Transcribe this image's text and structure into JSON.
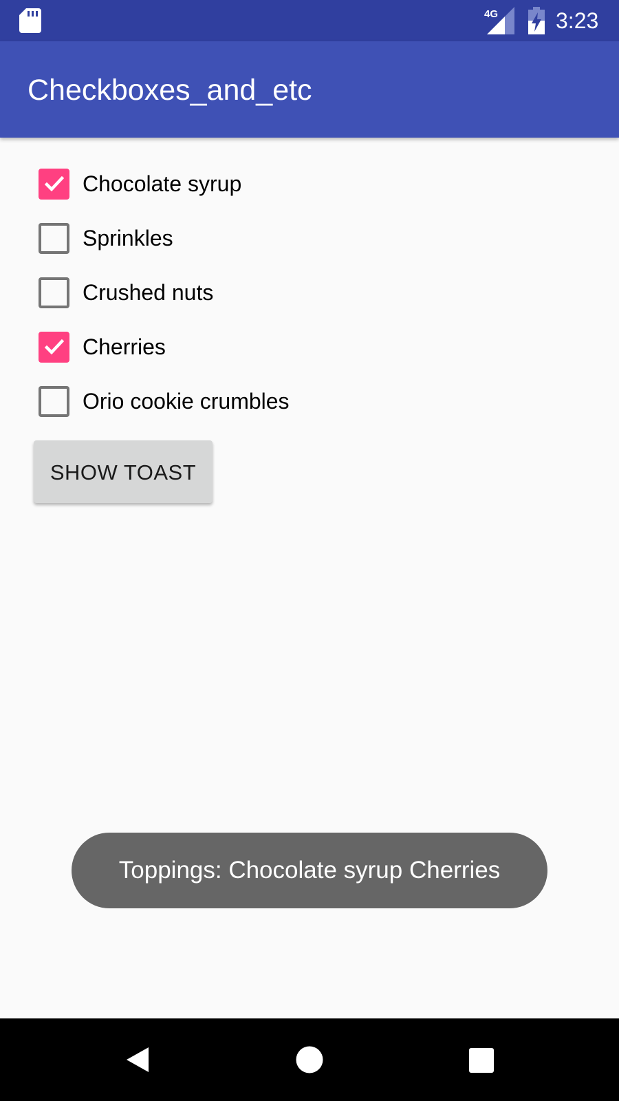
{
  "status_bar": {
    "time": "3:23",
    "network_label": "4G",
    "icons": [
      "sd-card-icon",
      "signal-4g-icon",
      "battery-charging-icon"
    ],
    "background_color": "#303f9f"
  },
  "app_bar": {
    "title": "Checkboxes_and_etc",
    "background_color": "#3f51b5"
  },
  "checkboxes": [
    {
      "label": "Chocolate syrup",
      "checked": true
    },
    {
      "label": "Sprinkles",
      "checked": false
    },
    {
      "label": "Crushed nuts",
      "checked": false
    },
    {
      "label": "Cherries",
      "checked": true
    },
    {
      "label": "Orio cookie crumbles",
      "checked": false
    }
  ],
  "button": {
    "label": "SHOW TOAST"
  },
  "toast": {
    "message": "Toppings: Chocolate syrup Cherries"
  },
  "nav_bar": {
    "icons": [
      "back-icon",
      "home-icon",
      "recents-icon"
    ]
  },
  "colors": {
    "accent": "#ff4081",
    "unchecked_border": "#757575",
    "toast_background": "#666666",
    "button_background": "#d6d7d7"
  }
}
